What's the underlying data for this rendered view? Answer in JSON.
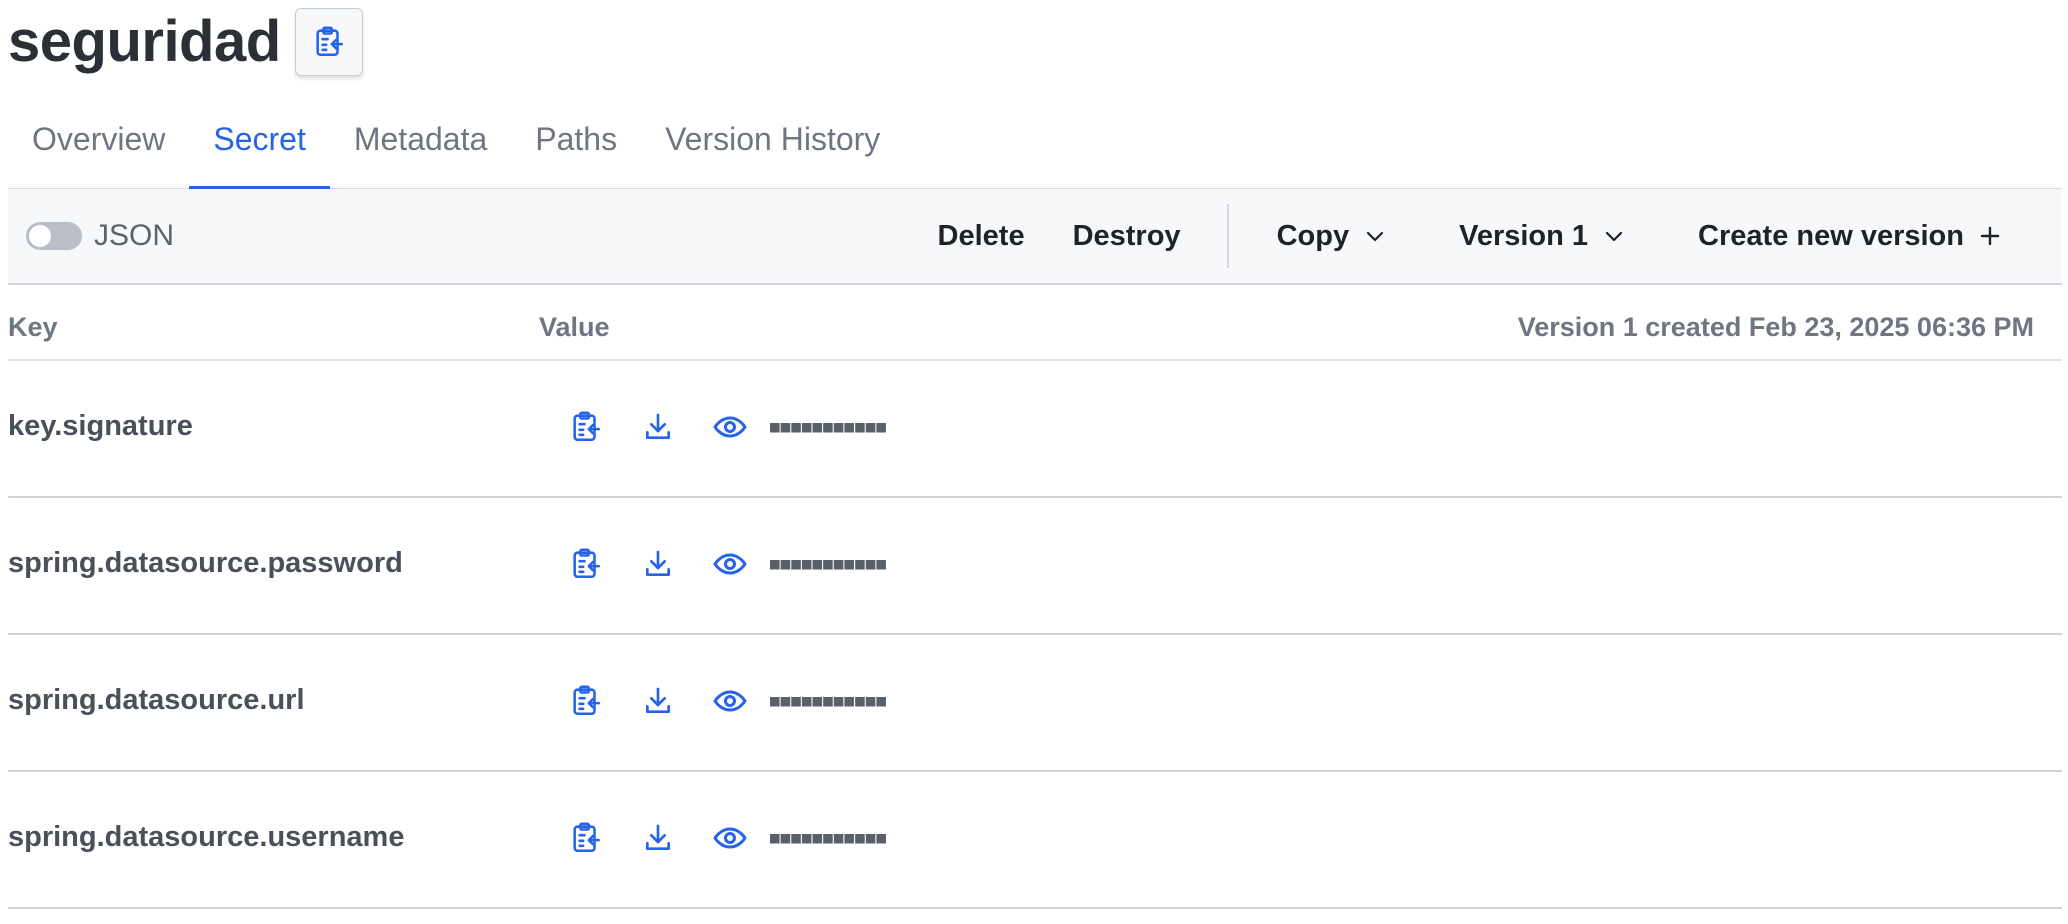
{
  "header": {
    "title": "seguridad",
    "copy_icon": "clipboard-arrow-icon"
  },
  "tabs": [
    {
      "label": "Overview",
      "active": false
    },
    {
      "label": "Secret",
      "active": true
    },
    {
      "label": "Metadata",
      "active": false
    },
    {
      "label": "Paths",
      "active": false
    },
    {
      "label": "Version History",
      "active": false
    }
  ],
  "toolbar": {
    "json_toggle_label": "JSON",
    "json_toggle_on": false,
    "delete_label": "Delete",
    "destroy_label": "Destroy",
    "copy_label": "Copy",
    "version_label": "Version 1",
    "create_label": "Create new version"
  },
  "table": {
    "key_header": "Key",
    "value_header": "Value",
    "version_info": "Version 1 created Feb 23, 2025 06:36 PM",
    "masked_value": "■■■■■■■■■■■",
    "rows": [
      {
        "key": "key.signature"
      },
      {
        "key": "spring.datasource.password"
      },
      {
        "key": "spring.datasource.url"
      },
      {
        "key": "spring.datasource.username"
      }
    ]
  },
  "colors": {
    "accent": "#2563eb",
    "muted_text": "#6f7682",
    "toolbar_bg": "#f7f8fa"
  }
}
